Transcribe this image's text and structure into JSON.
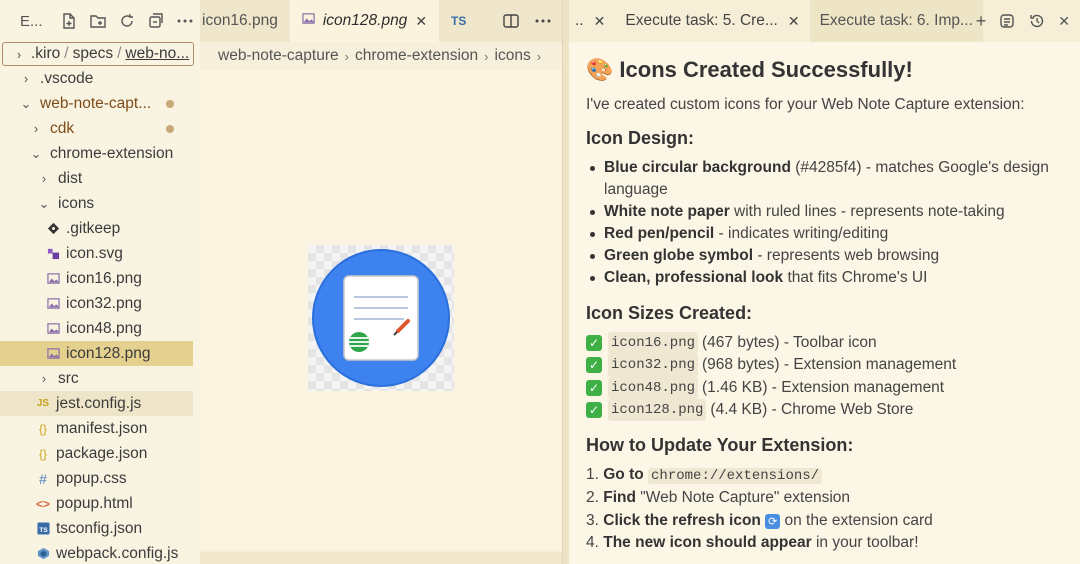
{
  "sidebar": {
    "title": "E...",
    "tree": [
      {
        "label": ".kiro / specs / web-no...",
        "parts": [
          ".kiro",
          "specs",
          "web-no..."
        ],
        "kind": "crumb"
      },
      {
        "label": ".vscode",
        "kind": "folder",
        "expanded": false
      },
      {
        "label": "web-note-capt...",
        "kind": "folder",
        "expanded": true,
        "modified": true
      },
      {
        "label": "cdk",
        "kind": "folder",
        "expanded": false,
        "modified": true
      },
      {
        "label": "chrome-extension",
        "kind": "folder",
        "expanded": true
      },
      {
        "label": "dist",
        "kind": "folder",
        "expanded": false
      },
      {
        "label": "icons",
        "kind": "folder",
        "expanded": true
      },
      {
        "label": ".gitkeep",
        "kind": "file"
      },
      {
        "label": "icon.svg",
        "kind": "file"
      },
      {
        "label": "icon16.png",
        "kind": "file"
      },
      {
        "label": "icon32.png",
        "kind": "file"
      },
      {
        "label": "icon48.png",
        "kind": "file"
      },
      {
        "label": "icon128.png",
        "kind": "file",
        "selected": true
      },
      {
        "label": "src",
        "kind": "folder",
        "expanded": false
      },
      {
        "label": "jest.config.js",
        "kind": "file"
      },
      {
        "label": "manifest.json",
        "kind": "file"
      },
      {
        "label": "package.json",
        "kind": "file"
      },
      {
        "label": "popup.css",
        "kind": "file"
      },
      {
        "label": "popup.html",
        "kind": "file"
      },
      {
        "label": "tsconfig.json",
        "kind": "file"
      },
      {
        "label": "webpack.config.js",
        "kind": "file"
      }
    ],
    "file_icons": {
      "gitkeep": "gear-file-icon",
      "svg": "svg-file-icon",
      "png": "image-file-icon",
      "js": "js-file-icon",
      "json": "json-file-icon",
      "css": "css-file-icon",
      "html": "html-file-icon",
      "tsconfig": "ts-file-icon",
      "webpack": "webpack-file-icon"
    }
  },
  "editor": {
    "tabs": [
      {
        "label": "icon16.png",
        "active": false
      },
      {
        "label": "icon128.png",
        "active": true
      },
      {
        "label": "TS",
        "active": false
      }
    ],
    "breadcrumbs": [
      "web-note-capture",
      "chrome-extension",
      "icons"
    ]
  },
  "chat": {
    "tabs": [
      {
        "label": "..",
        "active": false
      },
      {
        "label": "Execute task: 5. Cre...",
        "active": false
      },
      {
        "label": "Execute task: 6. Imp...",
        "active": true
      }
    ],
    "heading": "Icons Created Successfully!",
    "heading_emoji": "🎨",
    "intro": "I've created custom icons for your Web Note Capture extension:",
    "design_heading": "Icon Design:",
    "design_items": [
      {
        "bold": "Blue circular background",
        "rest": " (#4285f4) - matches Google's design language"
      },
      {
        "bold": "White note paper",
        "rest": " with ruled lines - represents note-taking"
      },
      {
        "bold": "Red pen/pencil",
        "rest": " - indicates writing/editing"
      },
      {
        "bold": "Green globe symbol",
        "rest": " - represents web browsing"
      },
      {
        "bold": "Clean, professional look",
        "rest": " that fits Chrome's UI"
      }
    ],
    "sizes_heading": "Icon Sizes Created:",
    "sizes": [
      {
        "file": "icon16.png",
        "rest": " (467 bytes) - Toolbar icon"
      },
      {
        "file": "icon32.png",
        "rest": " (968 bytes) - Extension management"
      },
      {
        "file": "icon48.png",
        "rest": " (1.46 KB) - Extension management"
      },
      {
        "file": "icon128.png",
        "rest": " (4.4 KB) - Chrome Web Store"
      }
    ],
    "update_heading": "How to Update Your Extension:",
    "steps": [
      {
        "num": "1.",
        "bold": "Go to",
        "code": "chrome://extensions/",
        "rest": ""
      },
      {
        "num": "2.",
        "bold": "Find",
        "code": "",
        "rest": " \"Web Note Capture\" extension"
      },
      {
        "num": "3.",
        "bold": "Click the refresh icon",
        "code": "",
        "rest": " on the extension card",
        "emoji": "🔄"
      },
      {
        "num": "4.",
        "bold": "The new icon should appear",
        "code": "",
        "rest": " in your toolbar!"
      }
    ],
    "colors": {
      "icon_bg": "#4285f4",
      "check": "#3fb045",
      "pen": "#e0552c",
      "globe": "#34a853"
    }
  }
}
